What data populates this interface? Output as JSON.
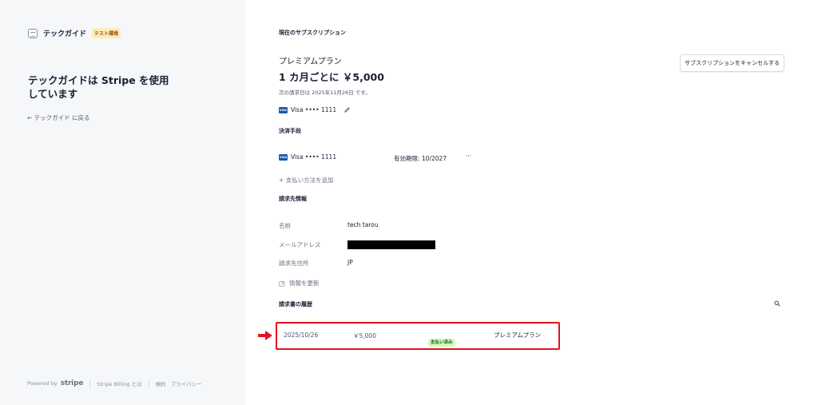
{
  "sidebar": {
    "brand_name": "テックガイド",
    "test_badge": "テスト環境",
    "title": "テックガイドは Stripe を使用しています",
    "back_link": "← テックガイド に戻る",
    "footer": {
      "powered_by": "Powered by",
      "stripe_logo": "stripe",
      "billing_link": "Stripe Billing とは",
      "terms_link": "規約",
      "privacy_link": "プライバシー"
    }
  },
  "subscription": {
    "heading": "現在のサブスクリプション",
    "plan_name": "プレミアムプラン",
    "price": "1 カ月ごとに ￥5,000",
    "next_billing": "次の請求日は 2025年11月26日 です。",
    "card": "Visa •••• 1111",
    "card_brand": "VISA",
    "cancel_button": "サブスクリプションをキャンセルする"
  },
  "payment": {
    "heading": "決済手段",
    "card": "Visa •••• 1111",
    "card_brand": "VISA",
    "expiry": "有効期限: 10/2027",
    "more": "···",
    "add_method": "+  支払い方法を追加"
  },
  "billing": {
    "heading": "請求先情報",
    "name_label": "名前",
    "name_value": "tech tarou",
    "email_label": "メールアドレス",
    "address_label": "請求先住所",
    "address_value": "JP",
    "update_link": "情報を更新"
  },
  "history": {
    "heading": "請求書の履歴",
    "rows": [
      {
        "date": "2025/10/26",
        "amount": "￥5,000",
        "status": "支払い済み",
        "plan": "プレミアムプラン"
      }
    ]
  },
  "colors": {
    "highlight_red": "#e3131d",
    "visa_blue": "#1a56b0",
    "paid_green_bg": "#d7f7c2"
  }
}
